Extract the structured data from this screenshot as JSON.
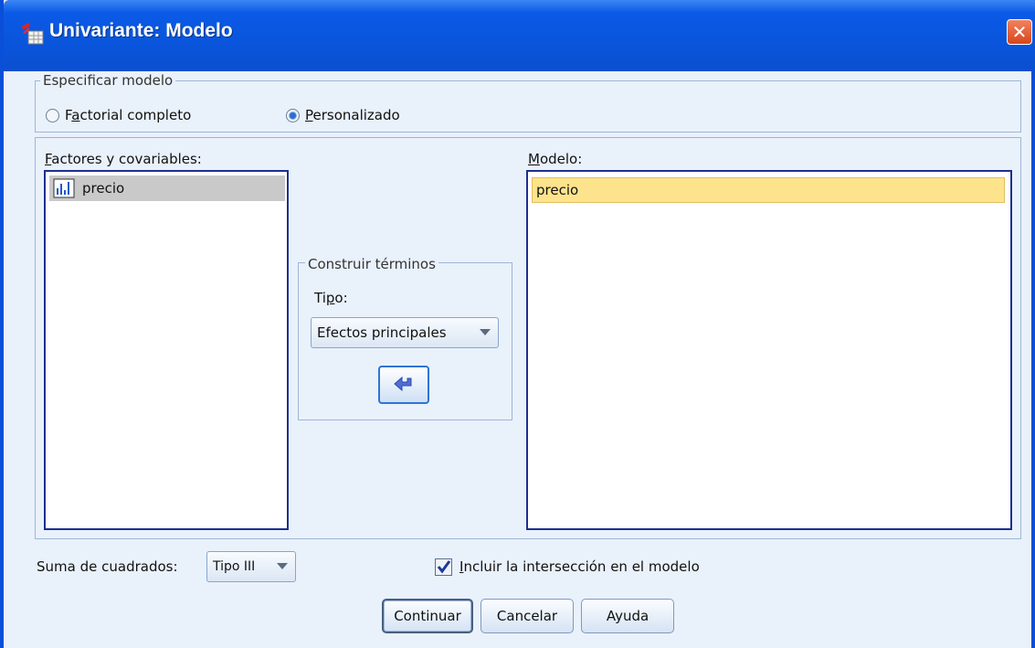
{
  "window": {
    "title": "Univariante: Modelo",
    "close_symbol": "✕"
  },
  "specify_model": {
    "legend": "Especificar modelo",
    "options": [
      {
        "label_before": "F",
        "label_ul": "a",
        "label_after": "ctorial completo",
        "selected": false
      },
      {
        "label_before": "",
        "label_ul": "P",
        "label_after": "ersonalizado",
        "selected": true
      }
    ]
  },
  "factors": {
    "label_ul": "F",
    "label_after": "actores y covariables:",
    "items": [
      {
        "name": "precio",
        "icon": "scale-variable-icon"
      }
    ]
  },
  "build_terms": {
    "legend": "Construir términos",
    "type_label_before": "Ti",
    "type_label_ul": "p",
    "type_label_after": "o:",
    "type_value": "Efectos principales",
    "move_icon": "arrow-left-icon"
  },
  "model": {
    "label_ul": "M",
    "label_after": "odelo:",
    "items": [
      "precio"
    ]
  },
  "sum_of_squares": {
    "label": "Suma de cuadrados:",
    "value": "Tipo III"
  },
  "intercept": {
    "label_ul": "I",
    "label_after": "ncluir la intersección en el modelo",
    "checked": true
  },
  "buttons": {
    "continue": "Continuar",
    "cancel": "Cancelar",
    "help": "Ayuda"
  },
  "colors": {
    "title_bar": "#0955dc",
    "selection_yellow": "#fde48c",
    "list_border": "#1d2f8f"
  }
}
